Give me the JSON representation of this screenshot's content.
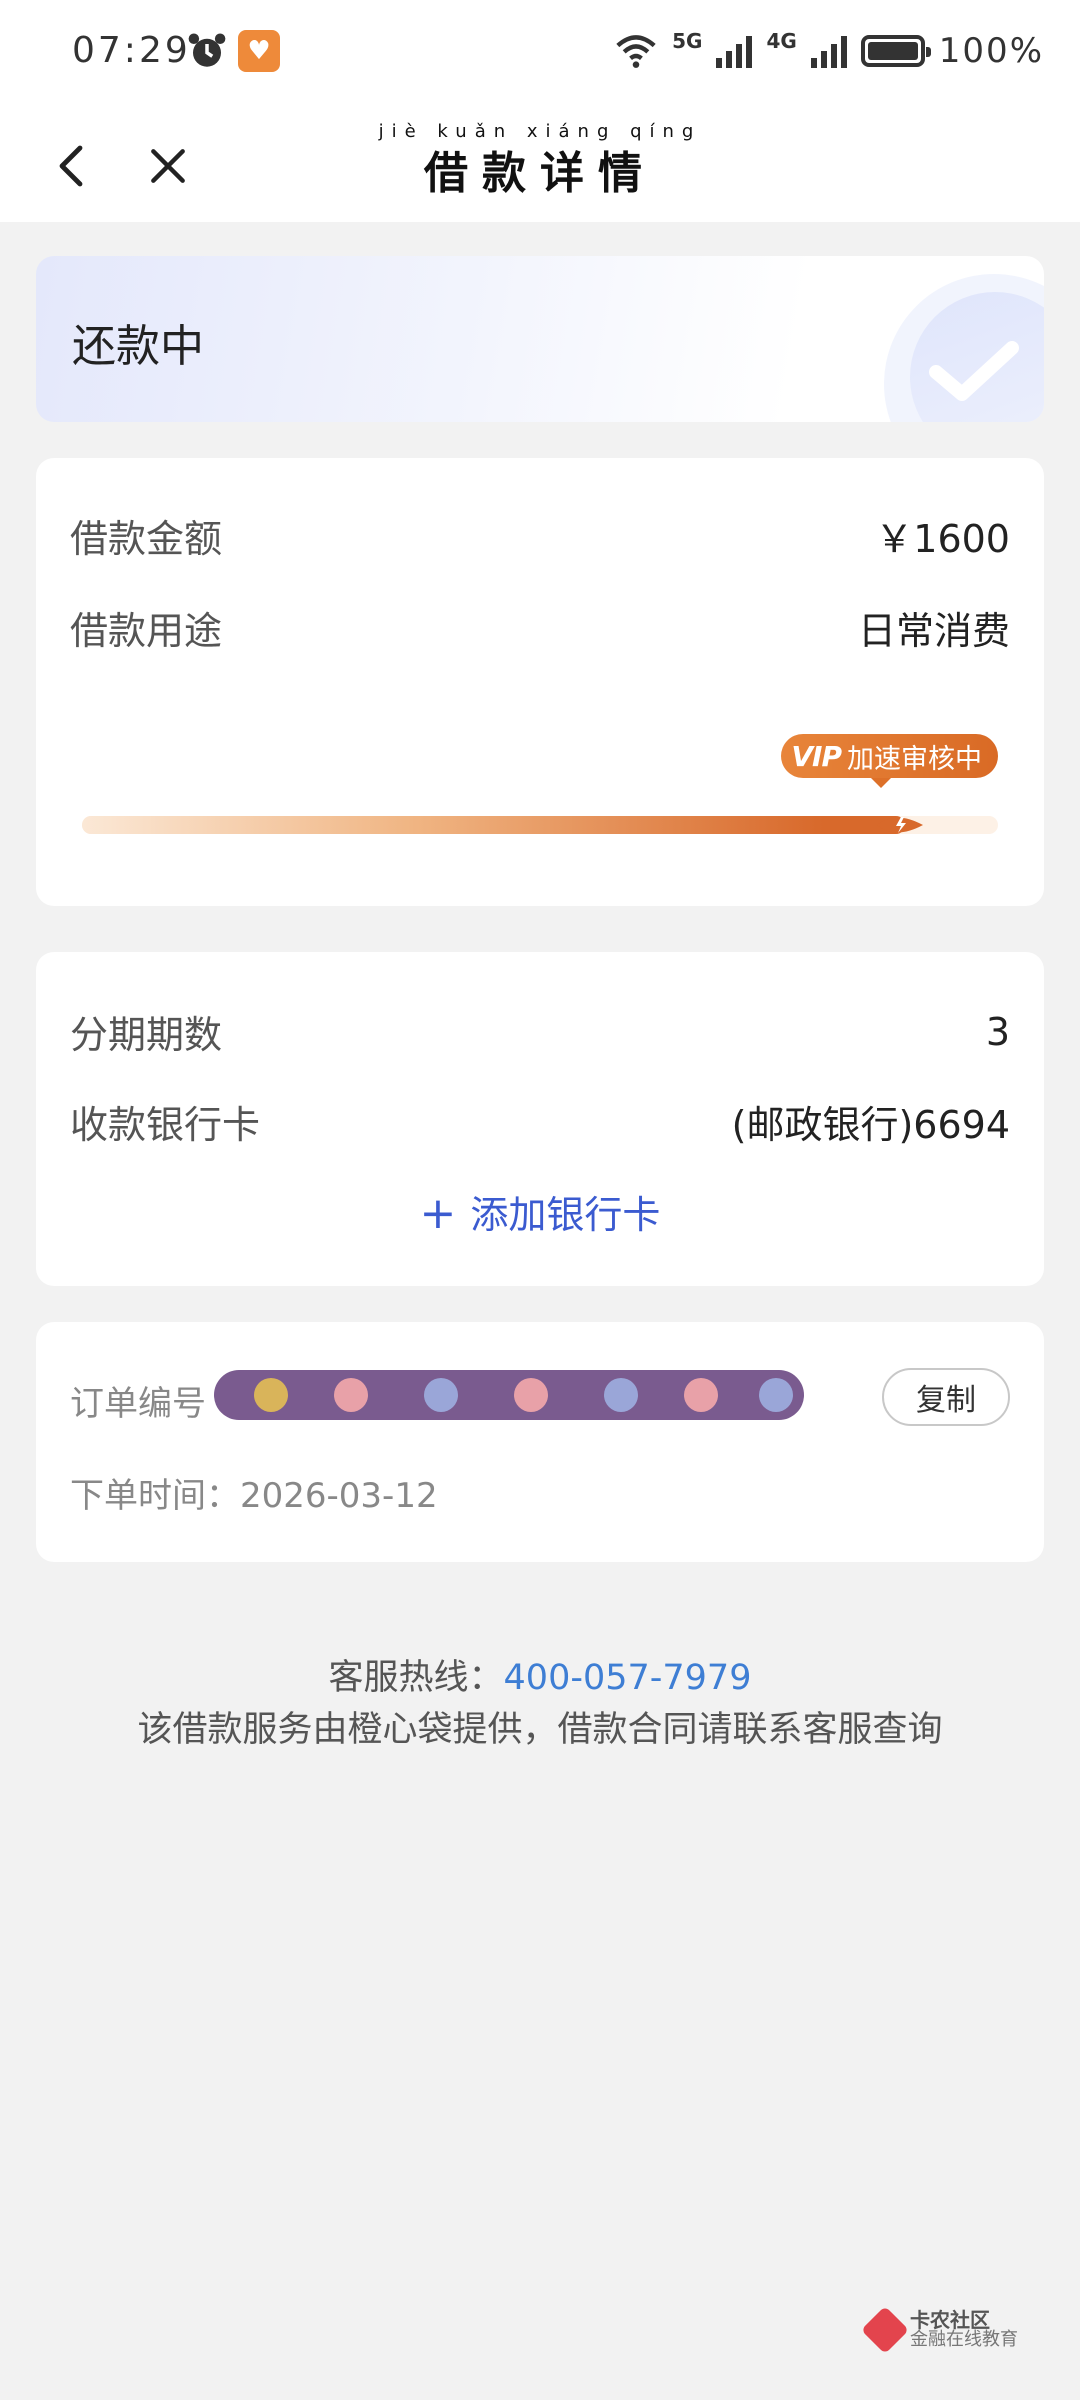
{
  "status_bar": {
    "time": "07:29",
    "network_1": "5G",
    "network_2": "4G",
    "battery": "100%"
  },
  "nav": {
    "title_pinyin": "jiè kuǎn xiáng qíng",
    "title": "借款详情"
  },
  "loan_status": {
    "text": "还款中"
  },
  "loan_info": {
    "amount_label": "借款金额",
    "amount_value": "￥1600",
    "purpose_label": "借款用途",
    "purpose_value": "日常消费",
    "badge_logo": "VIP",
    "badge_text": "加速审核中",
    "progress_fraction": 0.92
  },
  "installment": {
    "periods_label": "分期期数",
    "periods_value": "3",
    "bank_label": "收款银行卡",
    "bank_value": "(邮政银行)6694",
    "add_card": "添加银行卡"
  },
  "order": {
    "number_label": "订单编号",
    "copy_button": "复制",
    "time_text": "下单时间：2026-03-12"
  },
  "footer": {
    "hotline_label": "客服热线：",
    "hotline_number": "400-057-7979",
    "provider_note": "该借款服务由橙心袋提供，借款合同请联系客服查询"
  },
  "watermark": {
    "title": "卡农社区",
    "subtitle": "金融在线教育"
  },
  "colors": {
    "accent_orange": "#d96a25",
    "link_blue": "#3b5bd0",
    "hotline_blue": "#3e7ed4"
  }
}
